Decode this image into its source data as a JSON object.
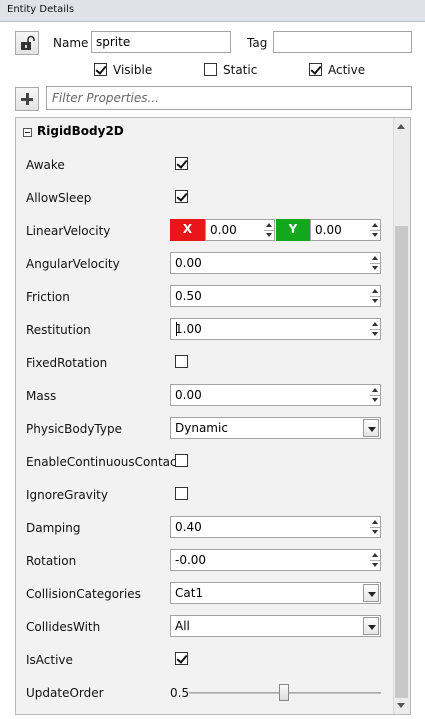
{
  "window": {
    "title": "Entity Details"
  },
  "entity": {
    "name_label": "Name",
    "name_value": "sprite",
    "tag_label": "Tag",
    "tag_value": "",
    "visible_label": "Visible",
    "visible_checked": true,
    "static_label": "Static",
    "static_checked": false,
    "active_label": "Active",
    "active_checked": true
  },
  "filter": {
    "placeholder": "Filter Properties..."
  },
  "group": {
    "title": "RigidBody2D"
  },
  "props": {
    "awake": {
      "label": "Awake",
      "checked": true
    },
    "allow_sleep": {
      "label": "AllowSleep",
      "checked": true
    },
    "linear_velocity": {
      "label": "LinearVelocity",
      "x_tag": "X",
      "x_value": "0.00",
      "y_tag": "Y",
      "y_value": "0.00",
      "x_color": "#e8161a",
      "y_color": "#12a81c"
    },
    "angular_velocity": {
      "label": "AngularVelocity",
      "value": "0.00"
    },
    "friction": {
      "label": "Friction",
      "value": "0.50"
    },
    "restitution": {
      "label": "Restitution",
      "value": "1.00"
    },
    "fixed_rotation": {
      "label": "FixedRotation",
      "checked": false
    },
    "mass": {
      "label": "Mass",
      "value": "0.00"
    },
    "physic_body_type": {
      "label": "PhysicBodyType",
      "value": "Dynamic"
    },
    "enable_continuous_contact": {
      "label": "EnableContinuousContact",
      "checked": false
    },
    "ignore_gravity": {
      "label": "IgnoreGravity",
      "checked": false
    },
    "damping": {
      "label": "Damping",
      "value": "0.40"
    },
    "rotation": {
      "label": "Rotation",
      "value": "-0.00"
    },
    "collision_categories": {
      "label": "CollisionCategories",
      "value": "Cat1"
    },
    "collides_with": {
      "label": "CollidesWith",
      "value": "All"
    },
    "is_active": {
      "label": "IsActive",
      "checked": true
    },
    "update_order": {
      "label": "UpdateOrder",
      "value": "0.5",
      "level": 0.5
    }
  }
}
